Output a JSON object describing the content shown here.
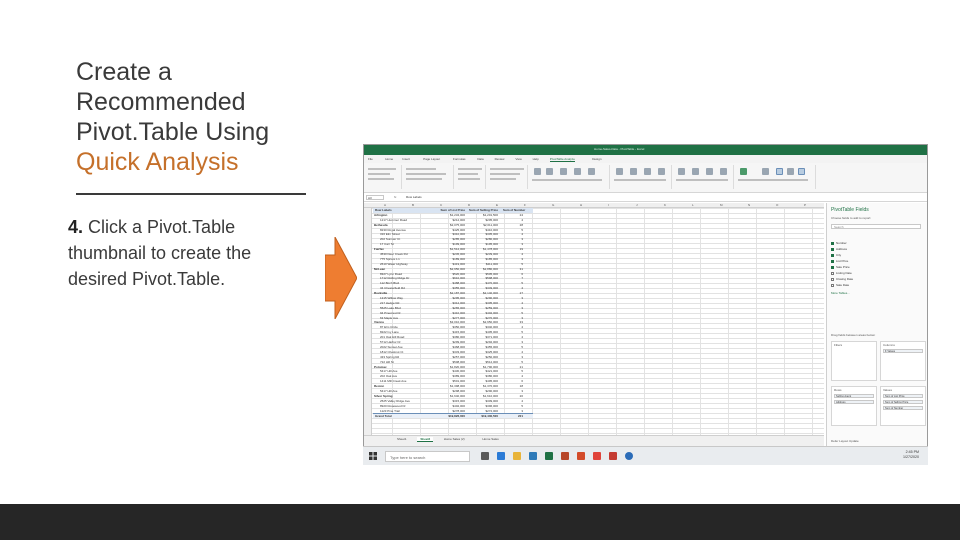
{
  "slide": {
    "title_line1": "Create a",
    "title_line2": "Recommended",
    "title_line3": "Pivot.Table Using",
    "title_highlight": "Quick Analysis",
    "step_number": "4.",
    "step_text": "Click a Pivot.Table thumbnail to create the desired Pivot.Table.",
    "accent_color": "#c5702a",
    "arrow_color": "#ee7d31",
    "bottom_bar_color": "#262626"
  },
  "excel": {
    "window_title": "Home-Sales-Data - PivotTable - Excel",
    "tabs": [
      "File",
      "Home",
      "Insert",
      "Page Layout",
      "Formulas",
      "Data",
      "Review",
      "View",
      "Help",
      "PivotTable Analyze",
      "Design"
    ],
    "active_tab": "PivotTable Analyze",
    "name_box": "A3",
    "fx": "fx",
    "formula_value": "Row Labels",
    "columns": [
      "A",
      "B",
      "C",
      "D",
      "E",
      "F",
      "G",
      "H",
      "I",
      "J",
      "K",
      "L",
      "M",
      "N",
      "O",
      "P"
    ],
    "pivot_header": [
      "Row Labels",
      "Sum of List Price",
      "Sum of Selling Price",
      "Sum of Number"
    ],
    "pivot_rows": [
      {
        "type": "grp",
        "label": "Arlington",
        "v1": "$1,234,000",
        "v2": "$1,201,500",
        "v3": "24"
      },
      {
        "type": "item",
        "label": "1217 Hummer Road",
        "v1": "$212,000",
        "v2": "$205,000",
        "v3": "4"
      },
      {
        "type": "grp",
        "label": "Bethesda",
        "v1": "$2,075,000",
        "v2": "$2,011,000",
        "v3": "28"
      },
      {
        "type": "item",
        "label": "8230 Royal Avenue",
        "v1": "$425,000",
        "v2": "$410,000",
        "v3": "5"
      },
      {
        "type": "item",
        "label": "316 Elm Street",
        "v1": "$310,000",
        "v2": "$305,000",
        "v3": "4"
      },
      {
        "type": "item",
        "label": "202 Sumner Ct",
        "v1": "$285,000",
        "v2": "$280,000",
        "v3": "3"
      },
      {
        "type": "item",
        "label": "17 Carr St",
        "v1": "$199,000",
        "v2": "$195,000",
        "v3": "3"
      },
      {
        "type": "grp",
        "label": "Fairfax",
        "v1": "$1,512,000",
        "v2": "$1,478,000",
        "v3": "19"
      },
      {
        "type": "item",
        "label": "4530 Deer Creek Rd",
        "v1": "$245,000",
        "v2": "$239,000",
        "v3": "4"
      },
      {
        "type": "item",
        "label": "775 Spruce Ln",
        "v1": "$189,000",
        "v2": "$185,000",
        "v3": "3"
      },
      {
        "type": "item",
        "label": "2610 Water Highway",
        "v1": "$419,000",
        "v2": "$411,000",
        "v3": "5"
      },
      {
        "type": "grp",
        "label": "McLean",
        "v1": "$2,950,000",
        "v2": "$2,880,000",
        "v3": "31"
      },
      {
        "type": "item",
        "label": "8327 Lynn Road",
        "v1": "$520,000",
        "v2": "$505,000",
        "v3": "6"
      },
      {
        "type": "item",
        "label": "1712 Rolling Ridge Dr",
        "v1": "$610,000",
        "v2": "$598,000",
        "v3": "7"
      },
      {
        "type": "item",
        "label": "112 Birch Blvd",
        "v1": "$488,000",
        "v2": "$470,000",
        "v3": "5"
      },
      {
        "type": "item",
        "label": "34 Chesterfield Rd",
        "v1": "$355,000",
        "v2": "$349,000",
        "v3": "4"
      },
      {
        "type": "grp",
        "label": "Rockville",
        "v1": "$2,187,000",
        "v2": "$2,140,000",
        "v3": "27"
      },
      {
        "type": "item",
        "label": "1315 Willow Way",
        "v1": "$295,000",
        "v2": "$290,000",
        "v3": "3"
      },
      {
        "type": "item",
        "label": "217 Hedge Rd",
        "v1": "$312,000",
        "v2": "$305,000",
        "v3": "4"
      },
      {
        "type": "item",
        "label": "5525 Lake Blvd",
        "v1": "$265,000",
        "v2": "$259,000",
        "v3": "3"
      },
      {
        "type": "item",
        "label": "94 Pinecrest Dr",
        "v1": "$410,000",
        "v2": "$402,000",
        "v3": "5"
      },
      {
        "type": "item",
        "label": "63 Maple Ave",
        "v1": "$277,000",
        "v2": "$270,000",
        "v3": "3"
      },
      {
        "type": "grp",
        "label": "Vienna",
        "v1": "$3,010,000",
        "v2": "$2,950,000",
        "v3": "33"
      },
      {
        "type": "item",
        "label": "87 Elm Circle",
        "v1": "$350,000",
        "v2": "$340,000",
        "v3": "4"
      },
      {
        "type": "item",
        "label": "8222 Ivy Lane",
        "v1": "$415,000",
        "v2": "$405,000",
        "v3": "5"
      },
      {
        "type": "item",
        "label": "201 Oak Hill Road",
        "v1": "$380,000",
        "v2": "$371,000",
        "v3": "4"
      },
      {
        "type": "item",
        "label": "5712 Harbor Dr",
        "v1": "$299,000",
        "v2": "$292,000",
        "v3": "3"
      },
      {
        "type": "item",
        "label": "2022 Sunset Ave",
        "v1": "$468,000",
        "v2": "$455,000",
        "v3": "5"
      },
      {
        "type": "item",
        "label": "1812 Chestnut Ct",
        "v1": "$333,000",
        "v2": "$325,000",
        "v3": "4"
      },
      {
        "type": "item",
        "label": "433 Spring Rd",
        "v1": "$257,000",
        "v2": "$250,000",
        "v3": "3"
      },
      {
        "type": "item",
        "label": "722 Hill St",
        "v1": "$508,000",
        "v2": "$512,000",
        "v3": "5"
      },
      {
        "type": "grp",
        "label": "Potomac",
        "v1": "$1,820,000",
        "v2": "$1,790,000",
        "v3": "21"
      },
      {
        "type": "item",
        "label": "5417 Hill Ave",
        "v1": "$430,000",
        "v2": "$421,000",
        "v3": "5"
      },
      {
        "type": "item",
        "label": "202 Oak Ave",
        "v1": "$389,000",
        "v2": "$380,000",
        "v3": "4"
      },
      {
        "type": "item",
        "label": "1411 Mill Creek Ave",
        "v1": "$501,000",
        "v2": "$495,000",
        "v3": "6"
      },
      {
        "type": "grp",
        "label": "Reston",
        "v1": "$1,398,000",
        "v2": "$1,370,000",
        "v3": "18"
      },
      {
        "type": "item",
        "label": "5417 Hill Ave",
        "v1": "$298,000",
        "v2": "$290,000",
        "v3": "3"
      },
      {
        "type": "grp",
        "label": "Silver Spring",
        "v1": "$1,640,000",
        "v2": "$1,610,000",
        "v3": "20"
      },
      {
        "type": "item",
        "label": "2525 Valley Ridge Ave",
        "v1": "$315,000",
        "v2": "$309,000",
        "v3": "4"
      },
      {
        "type": "item",
        "label": "8920 Rosewood Dr",
        "v1": "$402,000",
        "v2": "$396,000",
        "v3": "5"
      },
      {
        "type": "item",
        "label": "1123 Pine Trail",
        "v1": "$278,000",
        "v2": "$272,000",
        "v3": "3"
      },
      {
        "type": "tot",
        "label": "Grand Total",
        "v1": "$19,826,000",
        "v2": "$19,430,500",
        "v3": "221"
      }
    ],
    "sheet_tabs": [
      "Sheet1",
      "Sheet2",
      "Home Sales (2)",
      "Home Sales"
    ],
    "active_sheet": "Sheet2",
    "pane": {
      "title": "PivotTable Fields",
      "subtitle": "Choose fields to add to report:",
      "search_placeholder": "Search",
      "fields": [
        {
          "name": "Number",
          "checked": true
        },
        {
          "name": "Address",
          "checked": true
        },
        {
          "name": "City",
          "checked": true
        },
        {
          "name": "List Price",
          "checked": true
        },
        {
          "name": "Sale Price",
          "checked": true
        },
        {
          "name": "Listing Date",
          "checked": false
        },
        {
          "name": "Closing Date",
          "checked": false
        },
        {
          "name": "Sale Date",
          "checked": false
        }
      ],
      "more_tables": "More Tables...",
      "drag_hint": "Drag fields between areas below:",
      "areas": {
        "filters": "Filters",
        "columns": "Columns",
        "rows": "Rows",
        "values": "Values"
      },
      "columns_chips": [
        "Σ Values"
      ],
      "rows_chips": [
        "Selling Agent",
        "Address"
      ],
      "values_chips": [
        "Sum of List Price",
        "Sum of Selling Price",
        "Sum of Number"
      ],
      "defer_label": "Defer Layout Update"
    },
    "taskbar": {
      "search_placeholder": "Type here to search",
      "time": "2:45 PM",
      "date": "1/27/2020"
    }
  }
}
